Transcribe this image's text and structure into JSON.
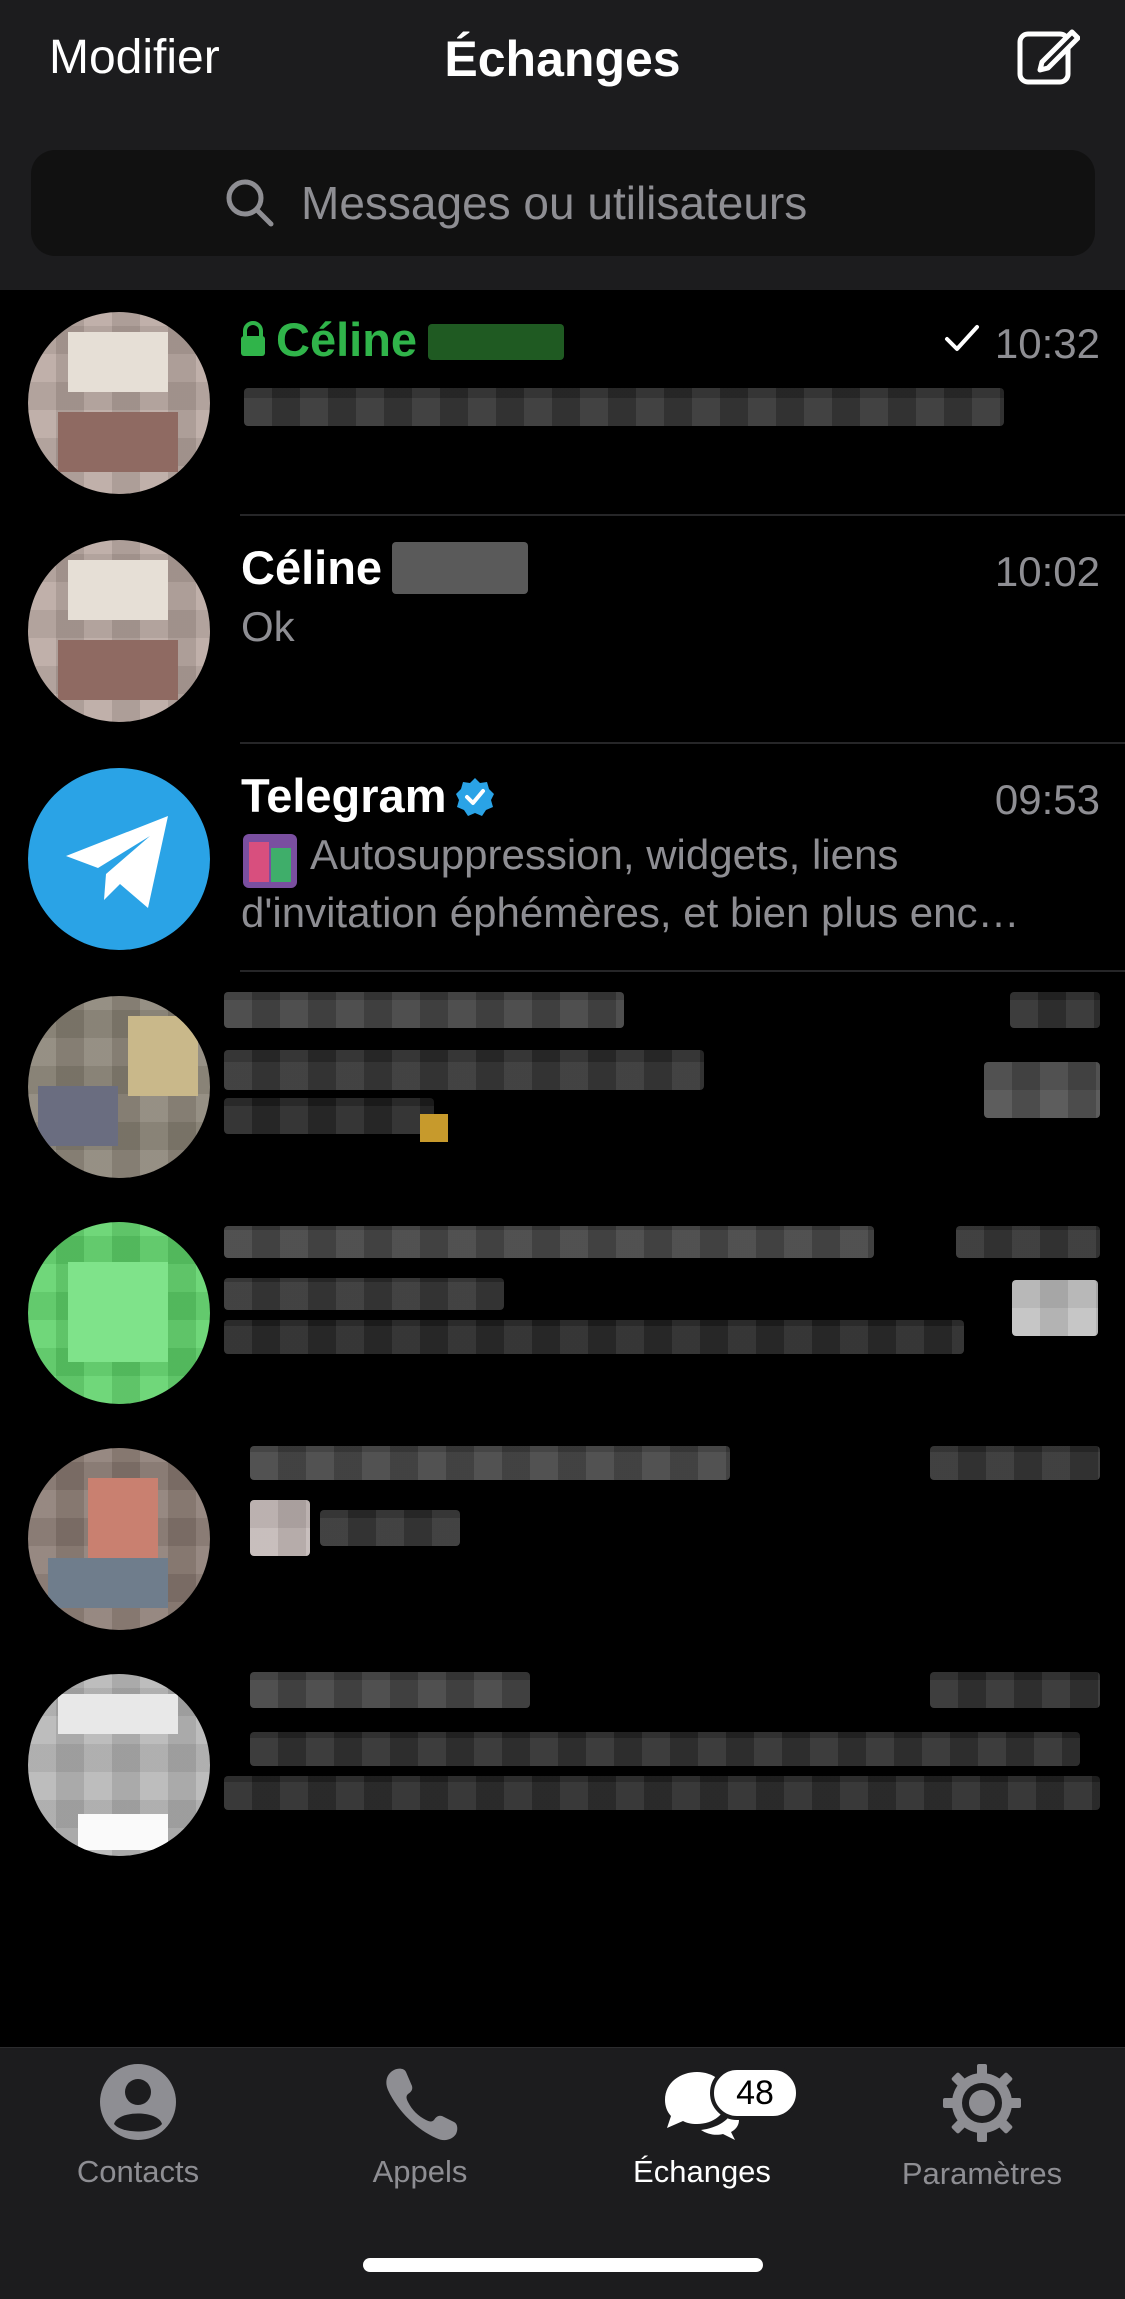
{
  "header": {
    "edit_label": "Modifier",
    "title": "Échanges",
    "compose_icon": "compose-icon"
  },
  "search": {
    "placeholder": "Messages ou utilisateurs"
  },
  "chats": [
    {
      "name": "Céline",
      "time": "10:32",
      "secret": true,
      "read_check": true,
      "name_color": "#30b44a"
    },
    {
      "name": "Céline",
      "time": "10:02",
      "preview": "Ok"
    },
    {
      "name": "Telegram",
      "time": "09:53",
      "verified": true,
      "preview_line1": "Autosuppression, widgets, liens",
      "preview_line2": "d'invitation éphémères, et bien plus enc…"
    }
  ],
  "tabbar": {
    "tabs": [
      {
        "label": "Contacts",
        "icon": "person-circle-icon"
      },
      {
        "label": "Appels",
        "icon": "phone-icon"
      },
      {
        "label": "Échanges",
        "icon": "chat-bubbles-icon",
        "badge": "48",
        "active": true
      },
      {
        "label": "Paramètres",
        "icon": "gear-icon"
      }
    ]
  },
  "colors": {
    "header_bg": "#1c1c1e",
    "secret_green": "#30b44a",
    "telegram_blue": "#2aa3e6",
    "muted_text": "#8e8e93"
  }
}
